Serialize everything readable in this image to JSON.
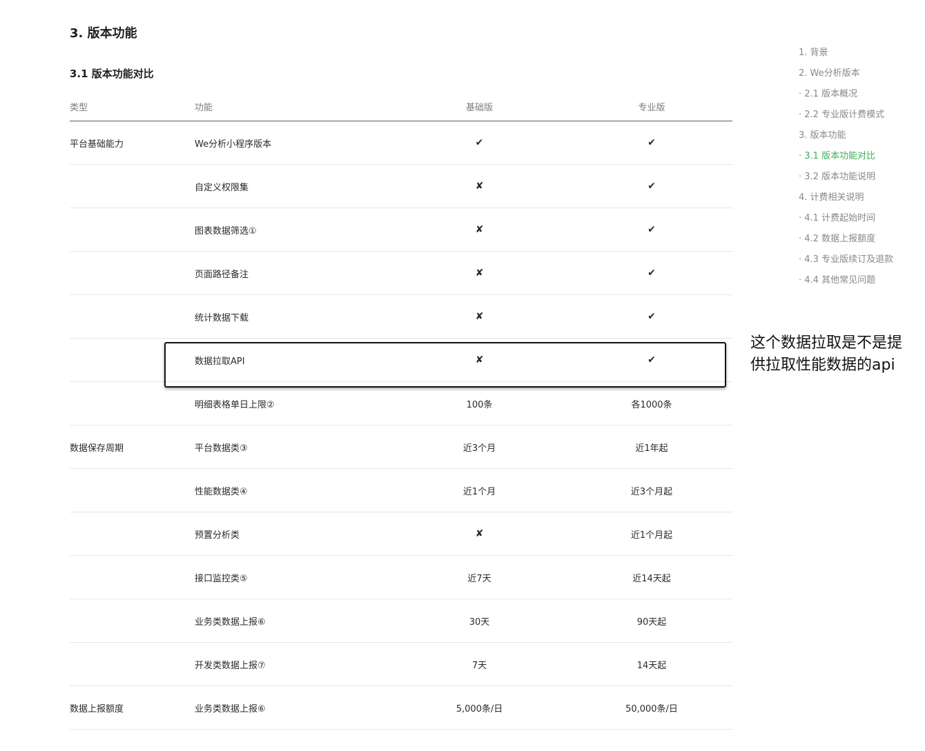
{
  "section_title": "3. 版本功能",
  "subsection_title": "3.1 版本功能对比",
  "table": {
    "headers": [
      "类型",
      "功能",
      "基础版",
      "专业版"
    ],
    "rows": [
      {
        "type": "平台基础能力",
        "feature": "We分析小程序版本",
        "basic": "✔",
        "pro": "✔"
      },
      {
        "type": "",
        "feature": "自定义权限集",
        "basic": "✘",
        "pro": "✔"
      },
      {
        "type": "",
        "feature": "图表数据筛选①",
        "basic": "✘",
        "pro": "✔"
      },
      {
        "type": "",
        "feature": "页面路径备注",
        "basic": "✘",
        "pro": "✔"
      },
      {
        "type": "",
        "feature": "统计数据下载",
        "basic": "✘",
        "pro": "✔"
      },
      {
        "type": "",
        "feature": "数据拉取API",
        "basic": "✘",
        "pro": "✔"
      },
      {
        "type": "",
        "feature": "明细表格单日上限②",
        "basic": "100条",
        "pro": "各1000条"
      },
      {
        "type": "数据保存周期",
        "feature": "平台数据类③",
        "basic": "近3个月",
        "pro": "近1年起"
      },
      {
        "type": "",
        "feature": "性能数据类④",
        "basic": "近1个月",
        "pro": "近3个月起"
      },
      {
        "type": "",
        "feature": "预置分析类",
        "basic": "✘",
        "pro": "近1个月起"
      },
      {
        "type": "",
        "feature": "接口监控类⑤",
        "basic": "近7天",
        "pro": "近14天起"
      },
      {
        "type": "",
        "feature": "业务类数据上报⑥",
        "basic": "30天",
        "pro": "90天起"
      },
      {
        "type": "",
        "feature": "开发类数据上报⑦",
        "basic": "7天",
        "pro": "14天起"
      },
      {
        "type": "数据上报额度",
        "feature": "业务类数据上报⑥",
        "basic": "5,000条/日",
        "pro": "50,000条/日"
      }
    ]
  },
  "annotation": "这个数据拉取是不是提供拉取性能数据的api",
  "toc": [
    {
      "label": "1. 背景",
      "active": false
    },
    {
      "label": "2. We分析版本",
      "active": false
    },
    {
      "label": "· 2.1 版本概况",
      "active": false
    },
    {
      "label": "· 2.2 专业版计费模式",
      "active": false
    },
    {
      "label": "3. 版本功能",
      "active": false
    },
    {
      "label": "· 3.1 版本功能对比",
      "active": true
    },
    {
      "label": "· 3.2 版本功能说明",
      "active": false
    },
    {
      "label": "4. 计费相关说明",
      "active": false
    },
    {
      "label": "· 4.1 计费起始时间",
      "active": false
    },
    {
      "label": "· 4.2 数据上报额度",
      "active": false
    },
    {
      "label": "· 4.3 专业版续订及退款",
      "active": false
    },
    {
      "label": "· 4.4 其他常见问题",
      "active": false
    }
  ],
  "colors": {
    "accent": "#3fae5b",
    "toc_text": "#888888",
    "header_text": "#7b7b7b",
    "row_border": "#e6e6e6"
  }
}
